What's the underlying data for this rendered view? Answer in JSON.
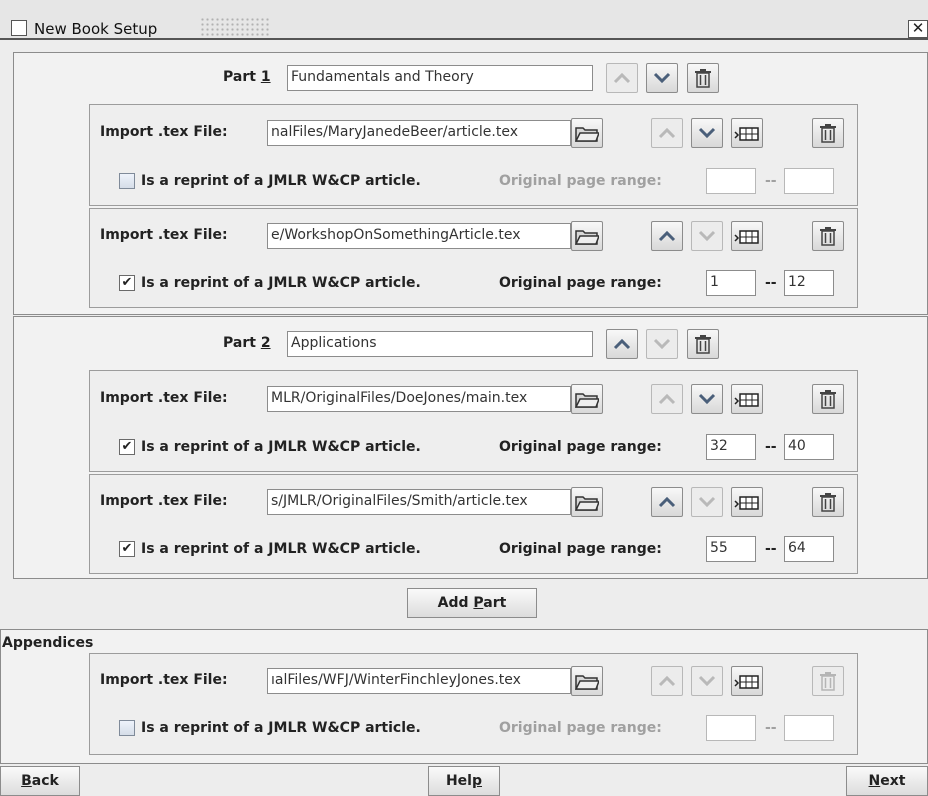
{
  "window": {
    "title": "New Book Setup",
    "close_glyph": "✕"
  },
  "parts": [
    {
      "label_prefix": "Part ",
      "number": "1",
      "title": "Fundamentals and Theory",
      "articles": [
        {
          "import_label": "Import .tex File:",
          "path": "nalFiles/MaryJanedeBeer/article.tex",
          "reprint_label": "Is a reprint of a JMLR W&CP article.",
          "reprint_checked": false,
          "range_label": "Original page range:",
          "range_start": "",
          "range_end": "",
          "range_separator": "--"
        },
        {
          "import_label": "Import .tex File:",
          "path": "e/WorkshopOnSomethingArticle.tex",
          "reprint_label": "Is a reprint of a JMLR W&CP article.",
          "reprint_checked": true,
          "range_label": "Original page range:",
          "range_start": "1",
          "range_end": "12",
          "range_separator": "--"
        }
      ]
    },
    {
      "label_prefix": "Part ",
      "number": "2",
      "title": "Applications",
      "articles": [
        {
          "import_label": "Import .tex File:",
          "path": "MLR/OriginalFiles/DoeJones/main.tex",
          "reprint_label": "Is a reprint of a JMLR W&CP article.",
          "reprint_checked": true,
          "range_label": "Original page range:",
          "range_start": "32",
          "range_end": "40",
          "range_separator": "--"
        },
        {
          "import_label": "Import .tex File:",
          "path": "s/JMLR/OriginalFiles/Smith/article.tex",
          "reprint_label": "Is a reprint of a JMLR W&CP article.",
          "reprint_checked": true,
          "range_label": "Original page range:",
          "range_start": "55",
          "range_end": "64",
          "range_separator": "--"
        }
      ]
    }
  ],
  "add_part_label_prefix": "Add ",
  "add_part_label_mnemonic": "P",
  "add_part_label_suffix": "art",
  "appendices": {
    "heading": "Appendices",
    "article": {
      "import_label": "Import .tex File:",
      "path": "ıalFiles/WFJ/WinterFinchleyJones.tex",
      "reprint_label": "Is a reprint of a JMLR W&CP article.",
      "reprint_checked": false,
      "range_label": "Original page range:",
      "range_start": "",
      "range_end": "",
      "range_separator": "--"
    }
  },
  "footer": {
    "back_mnemonic": "B",
    "back_rest": "ack",
    "help_prefix": "Hel",
    "help_mnemonic": "p",
    "next_mnemonic": "N",
    "next_rest": "ext"
  },
  "checkmark_glyph": "✔"
}
